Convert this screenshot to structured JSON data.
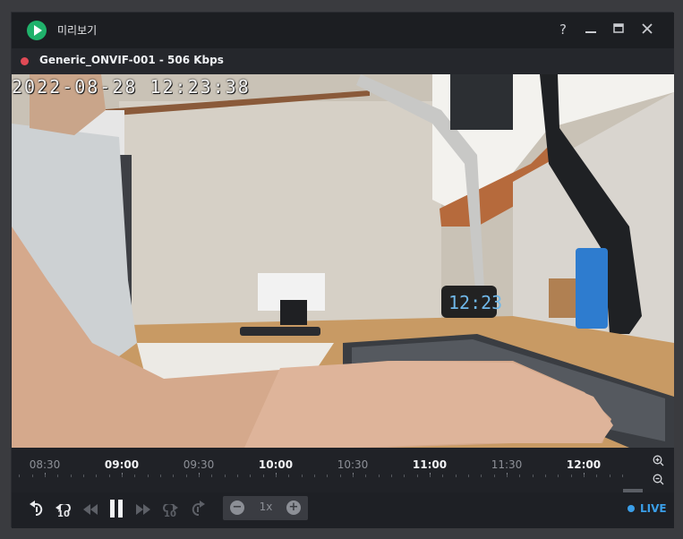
{
  "window": {
    "title": "미리보기",
    "help_label": "?",
    "minimize_label": "—",
    "maximize_label": "□",
    "close_label": "✕"
  },
  "stream": {
    "name": "Generic_ONVIF-001 - 506 Kbps",
    "status_color": "#e04a56"
  },
  "video": {
    "osd_timestamp": "2022-08-28 12:23:38",
    "clock_display": "12:23"
  },
  "timeline": {
    "ticks": [
      {
        "label": "08:30",
        "major": false
      },
      {
        "label": "09:00",
        "major": true
      },
      {
        "label": "09:30",
        "major": false
      },
      {
        "label": "10:00",
        "major": true
      },
      {
        "label": "10:30",
        "major": false
      },
      {
        "label": "11:00",
        "major": true
      },
      {
        "label": "11:30",
        "major": false
      },
      {
        "label": "12:00",
        "major": true
      }
    ],
    "zoom_in_icon": "zoom-in-icon",
    "zoom_out_icon": "zoom-out-icon"
  },
  "controls": {
    "skip_back_10_label": "10",
    "skip_forward_10_label": "10",
    "speed_value": "1x",
    "speed_minus": "−",
    "speed_plus": "+",
    "live_label": "LIVE",
    "accent_color": "#3a9ee8"
  }
}
